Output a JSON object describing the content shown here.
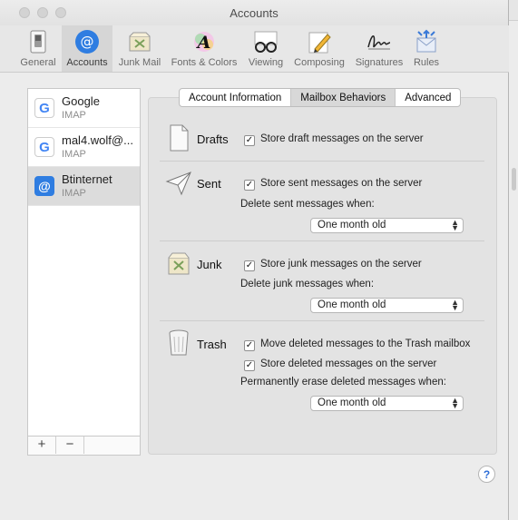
{
  "window": {
    "title": "Accounts"
  },
  "toolbar": {
    "items": [
      {
        "label": "General",
        "icon": "general-switch-icon"
      },
      {
        "label": "Accounts",
        "icon": "at-sign-icon"
      },
      {
        "label": "Junk Mail",
        "icon": "junk-tray-icon"
      },
      {
        "label": "Fonts & Colors",
        "icon": "fonts-colors-icon"
      },
      {
        "label": "Viewing",
        "icon": "glasses-icon"
      },
      {
        "label": "Composing",
        "icon": "pencil-icon"
      },
      {
        "label": "Signatures",
        "icon": "signature-icon"
      },
      {
        "label": "Rules",
        "icon": "rules-envelope-icon"
      }
    ],
    "active": "Accounts"
  },
  "accounts": [
    {
      "name": "Google",
      "type": "IMAP",
      "icon": "google-g-icon"
    },
    {
      "name": "mal4.wolf@...",
      "type": "IMAP",
      "icon": "google-g-icon"
    },
    {
      "name": "Btinternet",
      "type": "IMAP",
      "icon": "at-sign-icon",
      "selected": true
    }
  ],
  "list_footer": {
    "add": "+",
    "remove": "−"
  },
  "tabs": [
    {
      "label": "Account Information"
    },
    {
      "label": "Mailbox Behaviors",
      "selected": true
    },
    {
      "label": "Advanced"
    }
  ],
  "sections": {
    "drafts": {
      "title": "Drafts",
      "store_label": "Store draft messages on the server",
      "checked": true
    },
    "sent": {
      "title": "Sent",
      "store_label": "Store sent messages on the server",
      "checked": true,
      "delete_label": "Delete sent messages when:",
      "delete_value": "One month old"
    },
    "junk": {
      "title": "Junk",
      "store_label": "Store junk messages on the server",
      "checked": true,
      "delete_label": "Delete junk messages when:",
      "delete_value": "One month old"
    },
    "trash": {
      "title": "Trash",
      "move_label": "Move deleted messages to the Trash mailbox",
      "store_label": "Store deleted messages on the server",
      "checked": true,
      "erase_label": "Permanently erase deleted messages when:",
      "erase_value": "One month old"
    }
  },
  "help": "?",
  "colors": {
    "accent": "#2f7de1",
    "window_bg": "#ececec",
    "desktop": "#4a6fa0"
  }
}
